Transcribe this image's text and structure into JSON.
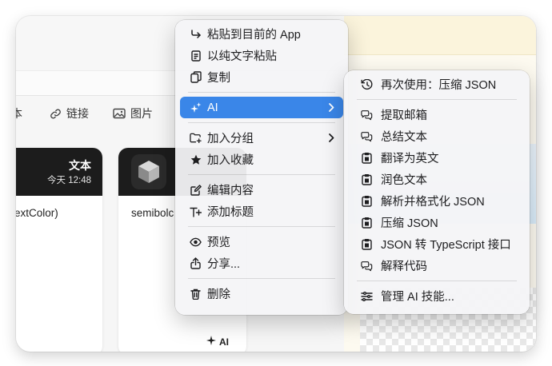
{
  "background_app": {
    "filters": [
      {
        "label": "本",
        "icon": ""
      },
      {
        "label": "链接",
        "icon": "link-icon"
      },
      {
        "label": "图片",
        "icon": "image-icon"
      }
    ],
    "cards": [
      {
        "type": "文本",
        "time": "今天 12:48",
        "content": "extColor)"
      },
      {
        "content": "semibolc",
        "tag": "AI"
      }
    ]
  },
  "context_menu": {
    "items": [
      {
        "label": "粘贴到目前的 App",
        "icon": "paste-to-app-icon"
      },
      {
        "label": "以纯文字粘贴",
        "icon": "plain-text-icon"
      },
      {
        "label": "复制",
        "icon": "copy-icon"
      },
      {
        "label": "AI",
        "icon": "sparkle-icon",
        "has_submenu": true,
        "highlighted": true
      },
      {
        "label": "加入分组",
        "icon": "folder-add-icon",
        "has_submenu": true
      },
      {
        "label": "加入收藏",
        "icon": "star-icon"
      },
      {
        "label": "编辑内容",
        "icon": "edit-icon"
      },
      {
        "label": "添加标题",
        "icon": "add-title-icon"
      },
      {
        "label": "预览",
        "icon": "eye-icon"
      },
      {
        "label": "分享...",
        "icon": "share-icon"
      },
      {
        "label": "删除",
        "icon": "trash-icon"
      }
    ]
  },
  "ai_submenu": {
    "items": [
      {
        "label": "再次使用：压缩 JSON",
        "icon": "history-icon"
      },
      {
        "label": "提取邮箱",
        "icon": "chat-bubbles-icon"
      },
      {
        "label": "总结文本",
        "icon": "chat-bubbles-icon"
      },
      {
        "label": "翻译为英文",
        "icon": "clipboard-icon"
      },
      {
        "label": "润色文本",
        "icon": "clipboard-icon"
      },
      {
        "label": "解析并格式化 JSON",
        "icon": "clipboard-icon"
      },
      {
        "label": "压缩 JSON",
        "icon": "clipboard-icon"
      },
      {
        "label": "JSON 转 TypeScript 接口",
        "icon": "clipboard-icon"
      },
      {
        "label": "解释代码",
        "icon": "chat-bubbles-icon"
      },
      {
        "label": "管理 AI 技能...",
        "icon": "sliders-icon"
      }
    ]
  },
  "colors": {
    "highlight": "#3a86e8"
  }
}
